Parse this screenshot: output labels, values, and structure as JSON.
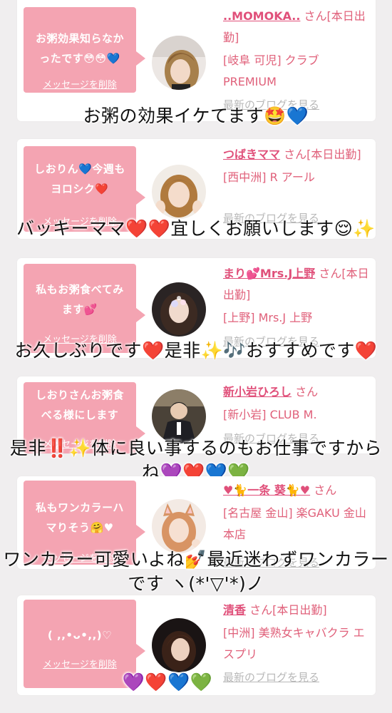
{
  "posts": [
    {
      "bubble": [
        "お粥効果知らなか",
        "ったです😳😳💙"
      ],
      "delete_label": "メッセージを削除",
      "name": "..MOMOKA..",
      "suffix": " さん[本日出勤]",
      "info_line": "[岐阜 可児] クラブPREMIUM",
      "blog_label": "最新のブログを見る",
      "caption": "お粥の効果イケてます🤩💙"
    },
    {
      "bubble": [
        "しおりん💙今週も",
        "ヨロシク❤️"
      ],
      "delete_label": "メッセージを削除",
      "name": "つばきママ",
      "suffix": " さん[本日出勤]",
      "info_line": "[西中洲] R アール",
      "blog_label": "最新のブログを見る",
      "caption": "バッキーママ❤️❤️宜しくお願いします😌✨"
    },
    {
      "bubble": [
        "私もお粥食べてみ",
        "ます💕"
      ],
      "delete_label": "メッセージを削除",
      "name": "まり💕Mrs.J上野",
      "suffix": " さん[本日出勤]",
      "info_line": "[上野] Mrs.J 上野",
      "blog_label": "最新のブログを見る",
      "caption": "お久しぶりです❤️是非✨🎶おすすめです❤️"
    },
    {
      "bubble": [
        "しおりさんお粥食",
        "べる様にします"
      ],
      "delete_label": "メッセージを削除",
      "name": "新小岩ひろし",
      "suffix": " さん",
      "info_line": "[新小岩] CLUB M.",
      "blog_label": "最新のブログを見る",
      "caption": "是非‼️✨体に良い事するのもお仕事ですから ね💜❤️💙💚"
    },
    {
      "bubble": [
        "私もワンカラーハ",
        "マりそう🤗♥"
      ],
      "delete_label": "メッセージを削除",
      "name": "♥🐈一条 葵🐈♥",
      "suffix": " さん",
      "info_line": "[名古屋 金山] 楽GAKU 金山本店",
      "blog_label": "最新のブログを見る",
      "caption": "ワンカラー可愛いよね💅最近迷わずワンカラーです ヽ(*'▽'*)ノ"
    },
    {
      "bubble": [
        "( ,,•ᴗ•,,)♡"
      ],
      "delete_label": "メッセージを削除",
      "name": "清香",
      "suffix": " さん[本日出勤]",
      "info_line": "[中洲] 美熟女キャバクラ エスプリ",
      "blog_label": "最新のブログを見る",
      "caption": "💜❤️💙💚"
    }
  ],
  "colors": {
    "page_bg": "#f0eeef",
    "card_bg": "#ffffff",
    "bubble_bg": "#f4a4b2",
    "name_text": "#e0507a",
    "blog_link_text": "#b8b8b8",
    "caption_text": "#111111"
  },
  "icons": [
    "avatar-photo",
    "heart-icon",
    "sparkle-icon",
    "music-notes-icon",
    "star-struck-face",
    "relieved-face",
    "hugging-face",
    "nail-polish-icon",
    "cat-icon"
  ]
}
